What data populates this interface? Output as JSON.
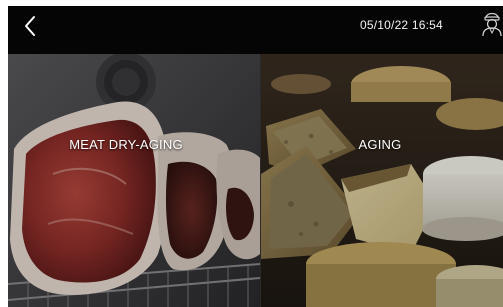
{
  "header": {
    "datetime": "05/10/22 16:54"
  },
  "tiles": [
    {
      "label": "MEAT DRY-AGING"
    },
    {
      "label": "AGING"
    }
  ],
  "icons": {
    "back": "chevron-left-icon",
    "user": "user-avatar-icon"
  },
  "colors": {
    "background": "#0a0a0a",
    "text": "#ffffff"
  }
}
